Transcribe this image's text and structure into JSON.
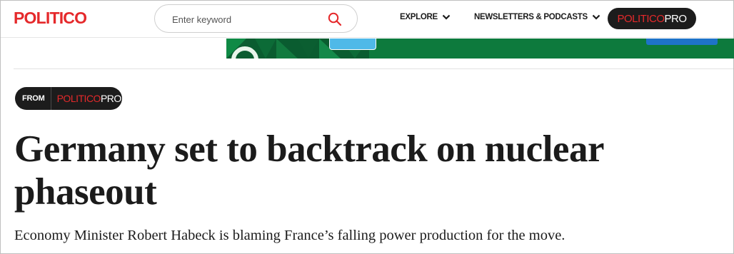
{
  "header": {
    "logo": "POLITICO",
    "search": {
      "placeholder": "Enter keyword"
    },
    "nav": [
      {
        "label": "EXPLORE"
      },
      {
        "label": "NEWSLETTERS & PODCASTS"
      }
    ],
    "pro_button": {
      "brand": "POLITICO",
      "suffix": "PRO"
    }
  },
  "colors": {
    "brand_red": "#e5292b",
    "dark": "#1c1c1c",
    "ad_green": "#0d7a3d"
  },
  "article": {
    "from_badge": {
      "from": "FROM",
      "brand": "POLITICO",
      "suffix": "PRO"
    },
    "headline": "Germany set to backtrack on nuclear phaseout",
    "dek": "Economy Minister Robert Habeck is blaming France’s falling power production for the move."
  }
}
